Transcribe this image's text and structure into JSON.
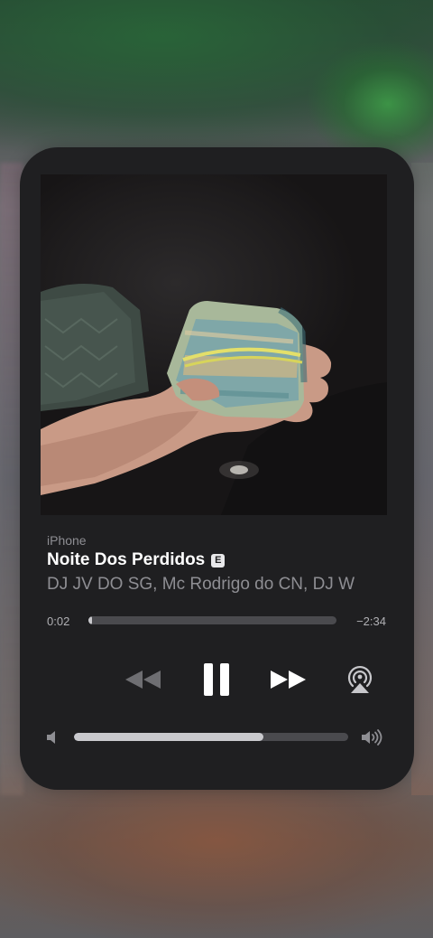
{
  "player": {
    "source": "iPhone",
    "title": "Noite Dos Perdidos",
    "explicit_badge": "E",
    "artists": "DJ JV DO SG, Mc Rodrigo do CN, DJ W",
    "elapsed": "0:02",
    "remaining": "−2:34",
    "progress_fraction": 0.013,
    "volume_fraction": 0.69,
    "artwork_icon": "album-artwork-hand-holding-cash-photo"
  },
  "controls": {
    "rewind_icon": "rewind-icon",
    "pause_icon": "pause-icon",
    "forward_icon": "fast-forward-icon",
    "airplay_icon": "airplay-icon",
    "volume_low_icon": "speaker-low-icon",
    "volume_high_icon": "speaker-high-icon"
  },
  "colors": {
    "card_background": "#1f1f21",
    "primary_text": "#ffffff",
    "secondary_text": "#8e8e93",
    "track": "#4a4a4e",
    "track_fill": "#c9c9cd",
    "rewind_disabled": "#6e6e72"
  }
}
